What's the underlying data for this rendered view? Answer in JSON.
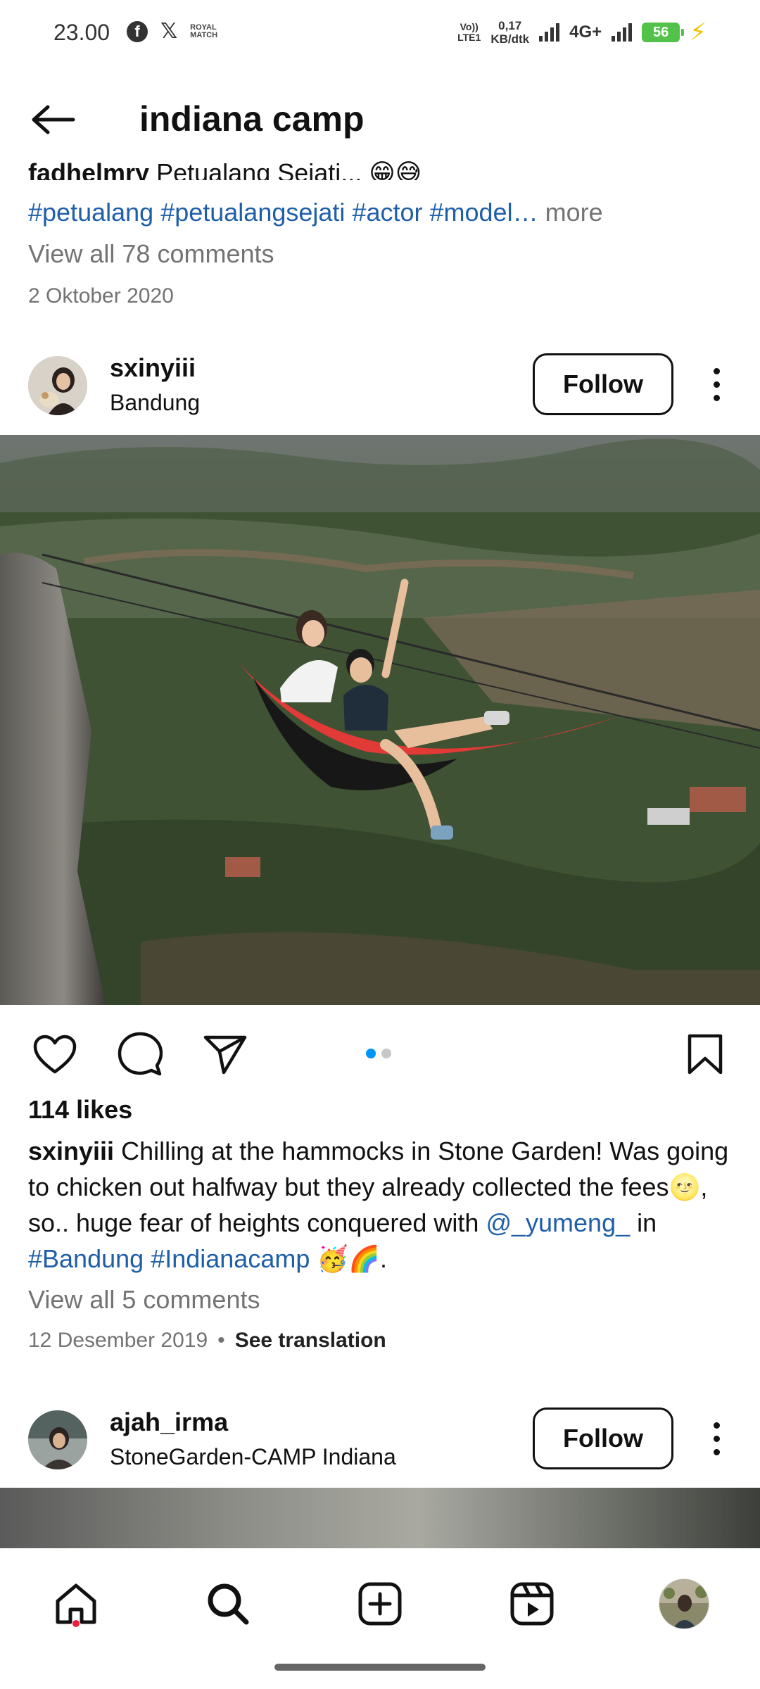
{
  "status_bar": {
    "time": "23.00",
    "icons_left": [
      "facebook-icon",
      "x-icon",
      "royal-match-icon"
    ],
    "royal_label": "ROYAL MATCH",
    "network_tag": "VoLTE1",
    "network_top": "Vo))",
    "network_bottom": "LTE1",
    "speed_value": "0,17",
    "speed_unit": "KB/dtk",
    "network_type": "4G+",
    "battery": "56",
    "charging": true,
    "accent": "#53c24a"
  },
  "header": {
    "title": "indiana camp",
    "back_icon": "arrow-left-icon"
  },
  "prev_post": {
    "cut_user": "fadhelmry",
    "cut_text": "Petualang Sejati... 😁😅",
    "hashtags": [
      "#petualang",
      "#petualangsejati",
      "#actor",
      "#model"
    ],
    "more": "more",
    "view_comments": "View all 78 comments",
    "date": "2 Oktober 2020"
  },
  "post1": {
    "username": "sxinyiii",
    "location": "Bandung",
    "follow_label": "Follow",
    "likes": "114 likes",
    "caption_user": "sxinyiii",
    "caption_part1": "Chilling at the hammocks in Stone Garden! Was going to chicken out halfway but they already collected the fees🌝, so.. huge fear of heights conquered with",
    "caption_mention": "@_yumeng_",
    "caption_in": "in",
    "caption_tag1": "#Bandung",
    "caption_tag2": "#Indianacamp",
    "caption_end": "🥳🌈.",
    "view_comments": "View all 5 comments",
    "date": "12 Desember 2019",
    "separator": "•",
    "see_translation": "See translation",
    "carousel": {
      "count": 2,
      "active": 1
    },
    "carousel_active_color": "#0095f6",
    "carousel_inactive_color": "#c7c7c7"
  },
  "post2": {
    "username": "ajah_irma",
    "location": "StoneGarden-CAMP Indiana",
    "follow_label": "Follow"
  },
  "bottom_nav": {
    "items": [
      "home-icon",
      "search-icon",
      "create-icon",
      "reels-icon",
      "profile-avatar"
    ],
    "active": "home-icon",
    "notification_color": "#ed1e3b"
  }
}
